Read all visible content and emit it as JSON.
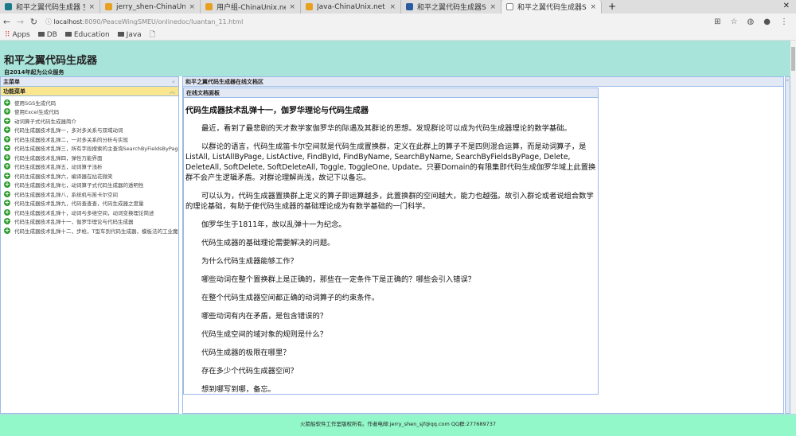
{
  "browser": {
    "tabs": [
      {
        "title": "和平之翼代码生成器 宝船",
        "color": "#1a7a8a"
      },
      {
        "title": "jerry_shen-ChinaUnix.net",
        "color": "#e8a020"
      },
      {
        "title": "用户组-ChinaUnix.net",
        "color": "#e8a020"
      },
      {
        "title": "Java-ChinaUnix.net",
        "color": "#e8a020"
      },
      {
        "title": "和平之翼代码生成器SMEU",
        "color": "#2a5aa0"
      },
      {
        "title": "和平之翼代码生成器SMEU",
        "color": "#ffffff"
      }
    ],
    "url_host": "localhost",
    "url_rest": ":8090/PeaceWingSMEU/onlinedoc/luantan_11.html",
    "bookmarks": [
      "Apps",
      "DB",
      "Education",
      "Java"
    ]
  },
  "header": {
    "title": "和平之翼代码生成器",
    "subtitle": "自2014年起为公众服务"
  },
  "left": {
    "title": "主菜单",
    "section": "功能菜单",
    "items": [
      "使用SGS生成代码",
      "使用Excel生成代码",
      "动词算子式代码生成器简介",
      "代码生成器技术乱弹一，多对多关系与双域动词",
      "代码生成器技术乱弹二，一对多关系的分析与实现",
      "代码生成器技术乱弹三，所有字段搜索的主查询SearchByFieldsByPage",
      "代码生成器技术乱弹四，弹性万能界面",
      "代码生成器技术乱弹五，动词算子浅析",
      "代码生成器技术乱弹六，编译器在拈花微笑",
      "代码生成器技术乱弹七，动词算子式代码生成器的透明性",
      "代码生成器技术乱弹八，系统机与笛卡尔空间",
      "代码生成器技术乱弹九，代码查查查，代码生成器之度量",
      "代码生成器技术乱弹十，动词与多维空间，动词变换理论简述",
      "代码生成器技术乱弹十一，伽罗华理论与代码生成器",
      "代码生成器技术乱弹十二，步枪，T型车到代码生成器，模板法的工业魔术"
    ]
  },
  "main": {
    "title": "和平之翼代码生成器在线文档区",
    "panel_title": "在线文档面板",
    "doc_title": "代码生成器技术乱弹十一，伽罗华理论与代码生成器",
    "paragraphs": [
      "最近，看到了最悲剧的天才数学家伽罗华的际遇及其群论的思想。发现群论可以成为代码生成器理论的数学基础。",
      "以群论的语言，代码生成笛卡尔空间就是代码生成置换群，定义在此群上的算子不是四则混合运算，而是动词算子，是ListAll, ListAllByPage, ListActive, FindById, FindByName, SearchByName, SearchByFieldsByPage, Delete, DeleteAll, SoftDelete, SoftDeleteAll, Toggle, ToggleOne, Update。只要Domain的有限集即代码生成伽罗华域上此置换群不会产生逻辑矛盾。对群论理解尚浅，故记下以备忘。",
      "可以认为，代码生成器置换群上定义的算子即运算越多，此置换群的空间越大，能力也越强。故引入群论或者说组合数学的理论基础，有助于使代码生成器的基础理论成为有数学基础的一门科学。",
      "伽罗华生于1811年，故以乱弹十一为纪念。",
      "代码生成器的基础理论需要解决的问题。",
      "为什么代码生成器能够工作？",
      "哪些动词在整个置换群上是正确的，那些在一定条件下是正确的？哪些会引入错误？",
      "在整个代码生成器空间都正确的动词算子的约束条件。",
      "哪些动词有内在矛盾，是包含错误的？",
      "代码生成空间的域对象的规则是什么？",
      "代码生成器的极限在哪里？",
      "存在多少个代码生成器空间？",
      "想到哪写到哪，备忘。"
    ]
  },
  "footer": "火箭船软件工作室版权所有。作者电邮:jerry_shen_sjf@qq.com QQ群:277689737"
}
